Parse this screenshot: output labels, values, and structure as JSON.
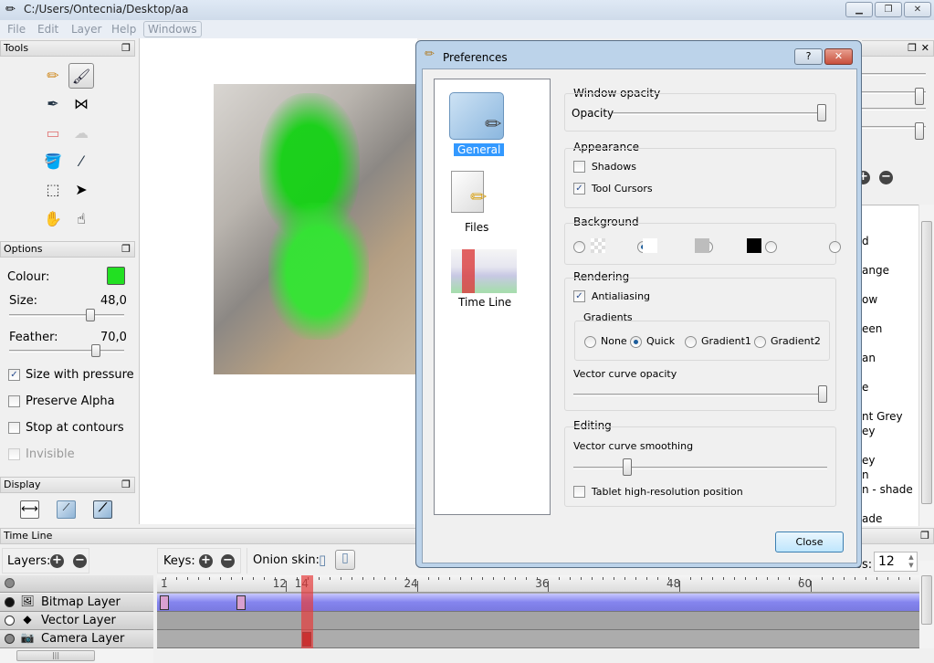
{
  "window": {
    "title": "C:/Users/Ontecnia/Desktop/aa",
    "minimize": "▁",
    "restore": "❐",
    "close": "✕"
  },
  "menu": [
    "File",
    "Edit",
    "Layer",
    "Help",
    "Windows"
  ],
  "tools_panel": {
    "title": "Tools",
    "tools": [
      "pencil",
      "brush",
      "pen",
      "polyline",
      "eraser",
      "smudge",
      "bucket",
      "eyedropper",
      "select",
      "move",
      "hand",
      "smudge-finger"
    ],
    "active": "brush"
  },
  "options_panel": {
    "title": "Options",
    "colour_label": "Colour:",
    "colour": "#22e022",
    "size_label": "Size:",
    "size_value": "48,0",
    "size_fraction": 0.72,
    "feather_label": "Feather:",
    "feather_value": "70,0",
    "feather_fraction": 0.78,
    "checks": [
      {
        "label": "Size with pressure",
        "checked": true,
        "disabled": false
      },
      {
        "label": "Preserve Alpha",
        "checked": false,
        "disabled": false
      },
      {
        "label": "Stop at contours",
        "checked": false,
        "disabled": false
      },
      {
        "label": "Invisible",
        "checked": false,
        "disabled": true
      }
    ]
  },
  "display_panel": {
    "title": "Display"
  },
  "dialog": {
    "title": "Preferences",
    "help": "?",
    "close_x": "✕",
    "categories": [
      "General",
      "Files",
      "Time Line"
    ],
    "selected_category": "General",
    "window_opacity": {
      "title": "Window opacity",
      "label": "Opacity",
      "fraction": 1.0
    },
    "appearance": {
      "title": "Appearance",
      "shadows": {
        "label": "Shadows",
        "checked": false
      },
      "tool_cursors": {
        "label": "Tool Cursors",
        "checked": true
      }
    },
    "background": {
      "title": "Background",
      "options": [
        "checkerboard",
        "white",
        "grey",
        "black",
        "custom"
      ],
      "selected": "white"
    },
    "rendering": {
      "title": "Rendering",
      "antialiasing": {
        "label": "Antialiasing",
        "checked": true
      },
      "gradients_title": "Gradients",
      "gradients": [
        "None",
        "Quick",
        "Gradient1",
        "Gradient2"
      ],
      "gradient_selected": "Quick",
      "vector_opacity_label": "Vector curve opacity",
      "vector_opacity_fraction": 1.0
    },
    "editing": {
      "title": "Editing",
      "smoothing_label": "Vector curve smoothing",
      "smoothing_fraction": 0.2,
      "tablet": {
        "label": "Tablet high-resolution position",
        "checked": false
      }
    },
    "close_button": "Close"
  },
  "right_panel": {
    "colour_names": [
      "d",
      "ange",
      "ow",
      "een",
      "an",
      "e",
      "nt Grey",
      "ey",
      "ey",
      "n",
      "n - shade",
      "ade"
    ],
    "fps_label": "os:",
    "fps_value": "12"
  },
  "timeline": {
    "title": "Time Line",
    "layers_label": "Layers:",
    "keys_label": "Keys:",
    "onion_label": "Onion skin:",
    "ruler_labels": [
      "1",
      "12",
      "14",
      "24",
      "36",
      "48",
      "60"
    ],
    "current_frame": 14,
    "layers": [
      {
        "name": "Bitmap Layer",
        "type": "bitmap",
        "visible": "filled",
        "keyframes": [
          1,
          8
        ]
      },
      {
        "name": "Vector Layer",
        "type": "vector",
        "visible": "empty",
        "keyframes": []
      },
      {
        "name": "Camera Layer",
        "type": "camera",
        "visible": "grey",
        "keyframes": [
          14
        ]
      }
    ]
  }
}
